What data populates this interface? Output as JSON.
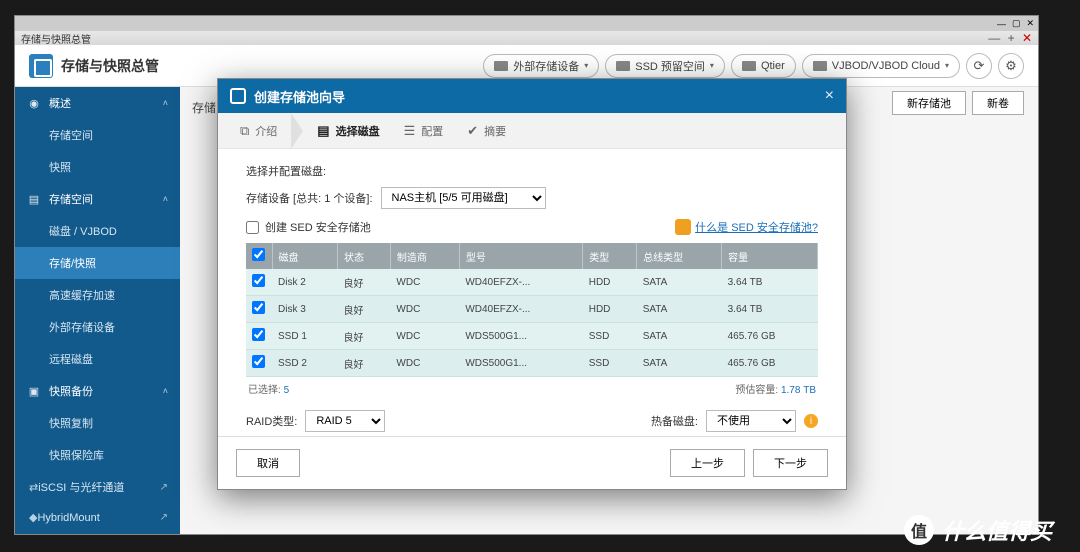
{
  "window": {
    "tab_title": "存储与快照总管"
  },
  "header": {
    "title": "存储与快照总管",
    "pills": [
      "外部存储设备",
      "SSD 预留空间",
      "Qtier",
      "VJBOD/VJBOD Cloud"
    ]
  },
  "sidebar": {
    "s_overview": "概述",
    "s_stspace": "存储空间",
    "s_snapshot": "快照",
    "g_storage": "存储空间",
    "s_diskvjbod": "磁盘 / VJBOD",
    "s_storsnap": "存储/快照",
    "s_cache": "高速缓存加速",
    "s_extdev": "外部存储设备",
    "s_remote": "远程磁盘",
    "g_backup": "快照备份",
    "s_srepl": "快照复制",
    "s_svault": "快照保险库",
    "l_iscsi": "iSCSI 与光纤通道",
    "l_hm": "HybridMount"
  },
  "topbar": {
    "content_title": "存储",
    "btn_newpool": "新存储池",
    "btn_new": "新卷"
  },
  "modal": {
    "title": "创建存储池向导",
    "steps": {
      "intro": "介绍",
      "select": "选择磁盘",
      "config": "配置",
      "summary": "摘要"
    },
    "sel_label": "选择并配置磁盘:",
    "dev_label": "存储设备 [总共: 1 个设备]:",
    "dev_value": "NAS主机 [5/5 可用磁盘]",
    "sed_label": "创建 SED 安全存储池",
    "sed_link": "什么是 SED 安全存储池?",
    "cols": {
      "c1": "磁盘",
      "c2": "状态",
      "c3": "制造商",
      "c4": "型号",
      "c5": "类型",
      "c6": "总线类型",
      "c7": "容量"
    },
    "rows": [
      {
        "d": "Disk 2",
        "s": "良好",
        "m": "WDC",
        "mo": "WD40EFZX-...",
        "t": "HDD",
        "b": "SATA",
        "c": "3.64 TB"
      },
      {
        "d": "Disk 3",
        "s": "良好",
        "m": "WDC",
        "mo": "WD40EFZX-...",
        "t": "HDD",
        "b": "SATA",
        "c": "3.64 TB"
      },
      {
        "d": "SSD 1",
        "s": "良好",
        "m": "WDC",
        "mo": "WDS500G1...",
        "t": "SSD",
        "b": "SATA",
        "c": "465.76 GB"
      },
      {
        "d": "SSD 2",
        "s": "良好",
        "m": "WDC",
        "mo": "WDS500G1...",
        "t": "SSD",
        "b": "SATA",
        "c": "465.76 GB"
      }
    ],
    "selected_label": "已选择:",
    "selected_count": "5",
    "est_label": "预估容量:",
    "est_val": "1.78 TB",
    "raid_label": "RAID类型:",
    "raid_value": "RAID 5",
    "spare_label": "热备磁盘:",
    "spare_value": "不使用",
    "btn_cancel": "取消",
    "btn_prev": "上一步",
    "btn_next": "下一步"
  },
  "watermark": "什么值得买"
}
